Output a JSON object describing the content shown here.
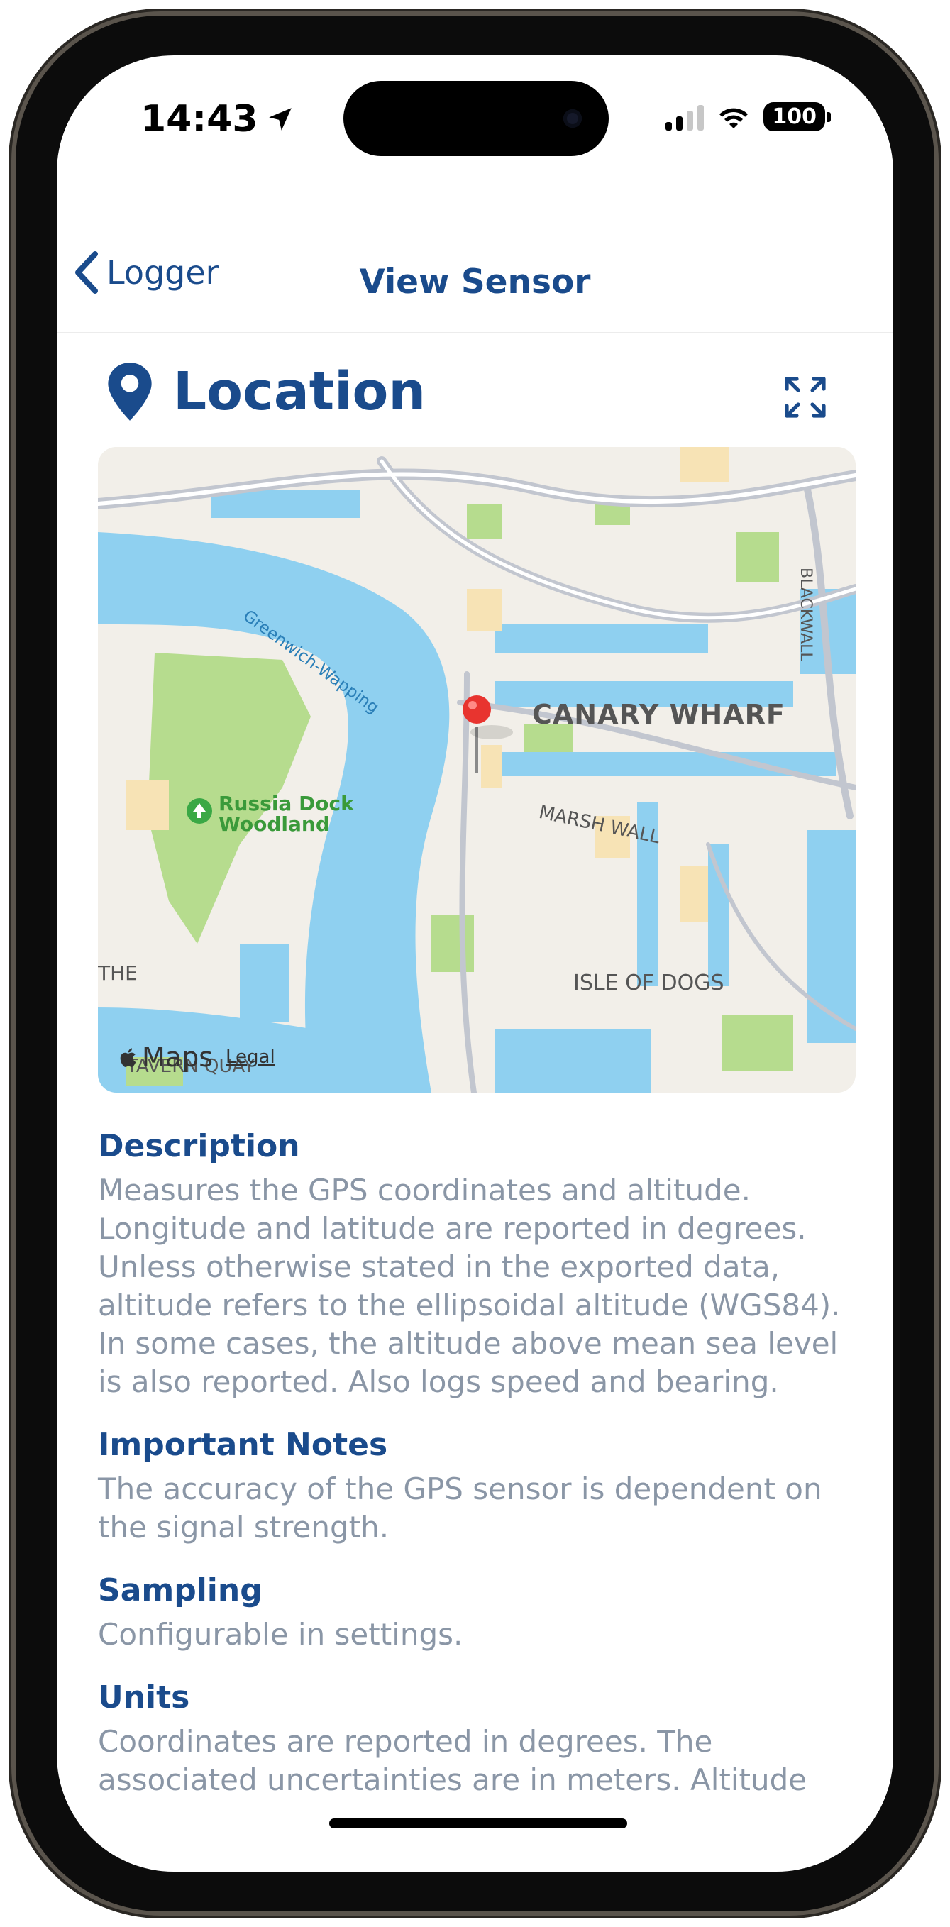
{
  "status_bar": {
    "time": "14:43",
    "battery": "100"
  },
  "nav": {
    "back_label": "Logger",
    "title": "View Sensor"
  },
  "page": {
    "title": "Location"
  },
  "map": {
    "labels": {
      "canary_wharf": "CANARY WHARF",
      "greenwich": "Greenwich-Wapping",
      "russia_dock": "Russia Dock\nWoodland",
      "marsh_wall": "MARSH WALL",
      "isle_of_dogs": "ISLE OF DOGS",
      "blackwall": "BLACKWALL",
      "the": "THE",
      "tavern_quay": "TAVERN QUAY",
      "maps": "Maps",
      "legal": "Legal"
    }
  },
  "sections": [
    {
      "heading": "Description",
      "body": "Measures the GPS coordinates and altitude. Longitude and latitude are reported in degrees. Unless otherwise stated in the exported data, altitude refers to the ellipsoidal altitude (WGS84). In some cases, the altitude above mean sea level is also reported. Also logs speed and bearing."
    },
    {
      "heading": "Important Notes",
      "body": "The accuracy of the GPS sensor is dependent on the signal strength."
    },
    {
      "heading": "Sampling",
      "body": "Configurable in settings."
    },
    {
      "heading": "Units",
      "body": "Coordinates are reported in degrees. The associated uncertainties are in meters. Altitude"
    }
  ],
  "colors": {
    "accent": "#1a4b8c",
    "body_text": "#8a96a6",
    "water": "#8fd0f0",
    "park": "#b6dc8e"
  }
}
